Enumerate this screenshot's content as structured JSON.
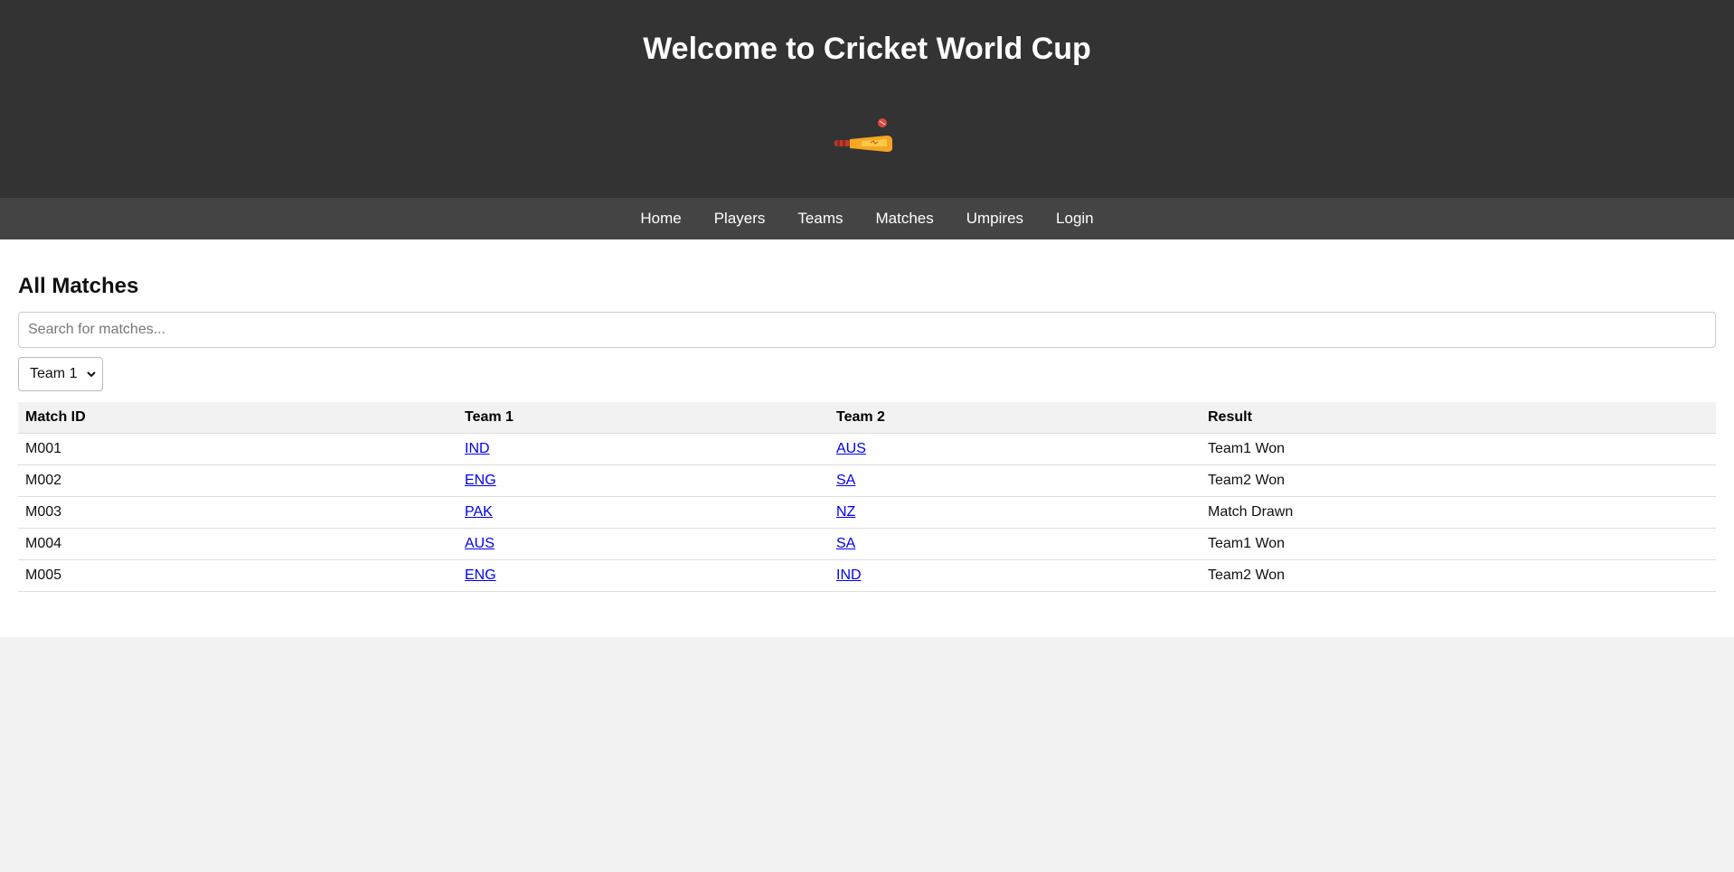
{
  "header": {
    "title": "Welcome to Cricket World Cup",
    "logo_icon": "cricket-bat-ball-icon"
  },
  "nav": {
    "items": [
      "Home",
      "Players",
      "Teams",
      "Matches",
      "Umpires",
      "Login"
    ]
  },
  "main": {
    "heading": "All Matches",
    "search_placeholder": "Search for matches...",
    "filter_selected": "Team 1",
    "table": {
      "columns": [
        "Match ID",
        "Team 1",
        "Team 2",
        "Result"
      ],
      "rows": [
        [
          "M001",
          "IND",
          "AUS",
          "Team1 Won"
        ],
        [
          "M002",
          "ENG",
          "SA",
          "Team2 Won"
        ],
        [
          "M003",
          "PAK",
          "NZ",
          "Match Drawn"
        ],
        [
          "M004",
          "AUS",
          "SA",
          "Team1 Won"
        ],
        [
          "M005",
          "ENG",
          "IND",
          "Team2 Won"
        ]
      ]
    }
  },
  "colors": {
    "header_bg": "#333333",
    "nav_bg": "#444444",
    "link": "#0000ee"
  }
}
